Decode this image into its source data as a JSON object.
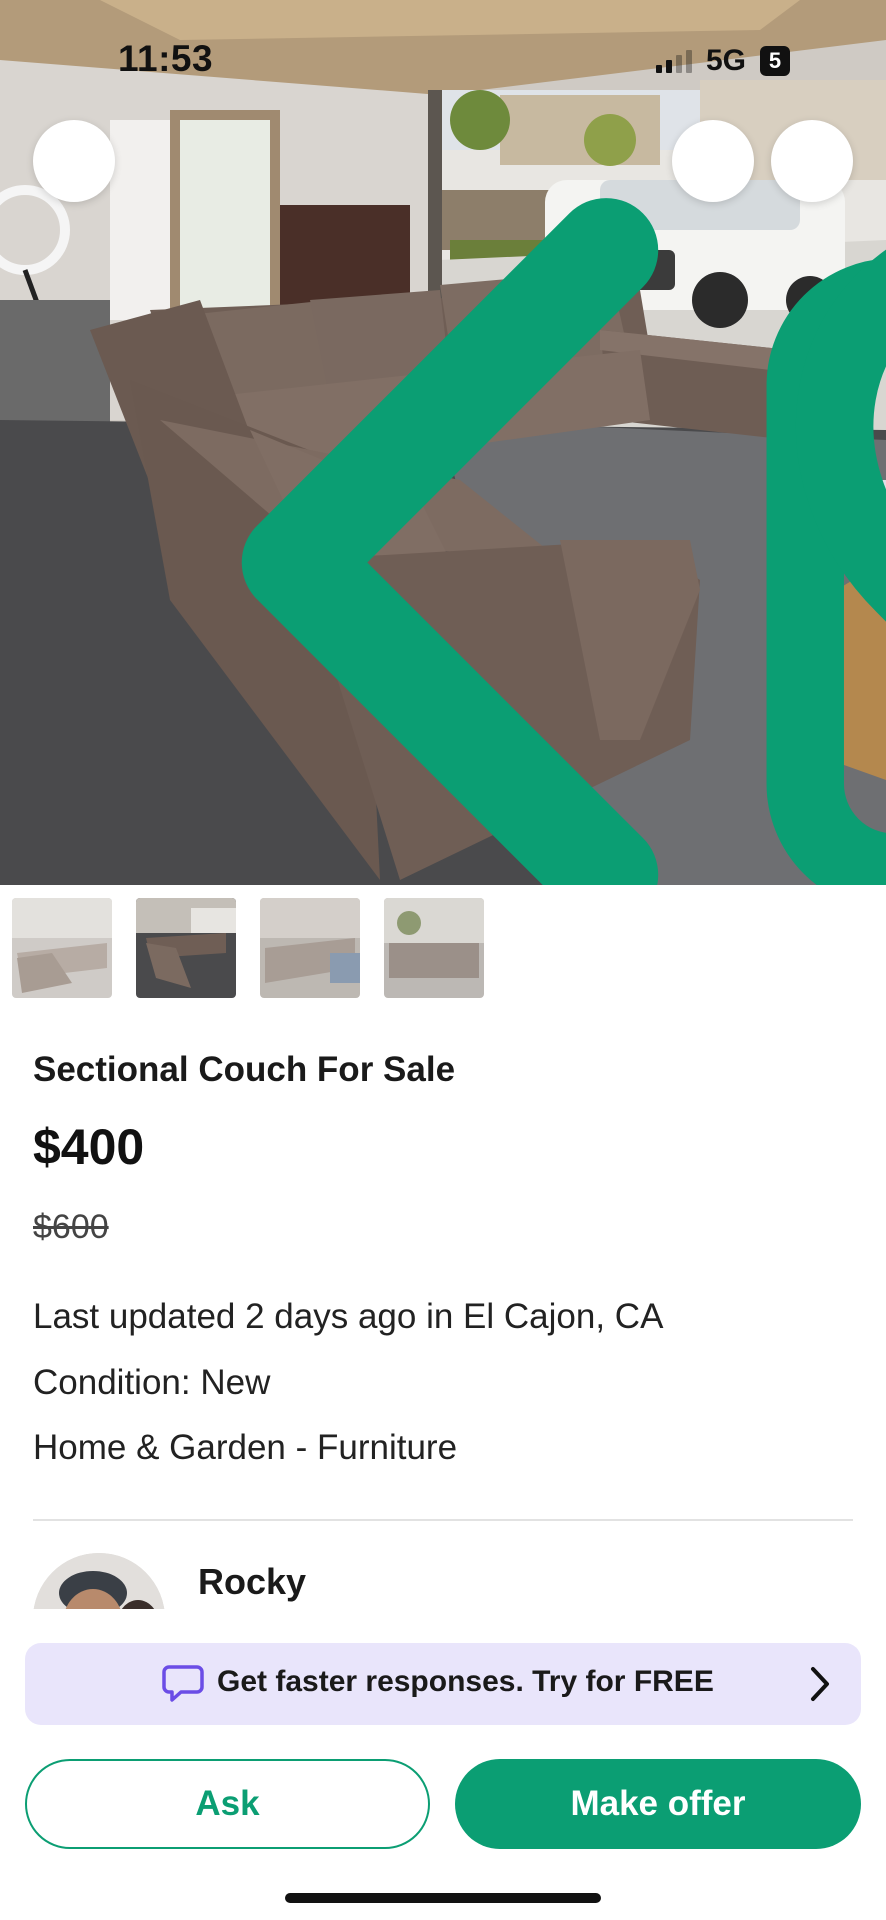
{
  "status_bar": {
    "time": "11:53",
    "network": "5G",
    "battery": "5"
  },
  "hero": {
    "image": "sectional-couch-in-garage-photo",
    "actions": {
      "back_icon": "chevron-left-icon",
      "share_icon": "share-icon",
      "favorite_icon": "heart-icon"
    }
  },
  "thumbnails": [
    {
      "name": "photo-1",
      "selected": false
    },
    {
      "name": "photo-2",
      "selected": true
    },
    {
      "name": "photo-3",
      "selected": false
    },
    {
      "name": "photo-4",
      "selected": false
    }
  ],
  "listing": {
    "title": "Sectional Couch For Sale",
    "price": "$400",
    "original_price": "$600",
    "updated": "Last updated 2 days ago in El Cajon, CA",
    "condition": "Condition: New",
    "category": "Home & Garden - Furniture"
  },
  "seller": {
    "name": "Rocky"
  },
  "promo": {
    "text": "Get faster responses.  Try for FREE",
    "icon": "chat-bubble-icon"
  },
  "actions": {
    "ask_label": "Ask",
    "offer_label": "Make offer"
  },
  "colors": {
    "accent": "#0b9e73",
    "promo_bg": "#e9e5fb",
    "promo_icon": "#6b4de6"
  }
}
